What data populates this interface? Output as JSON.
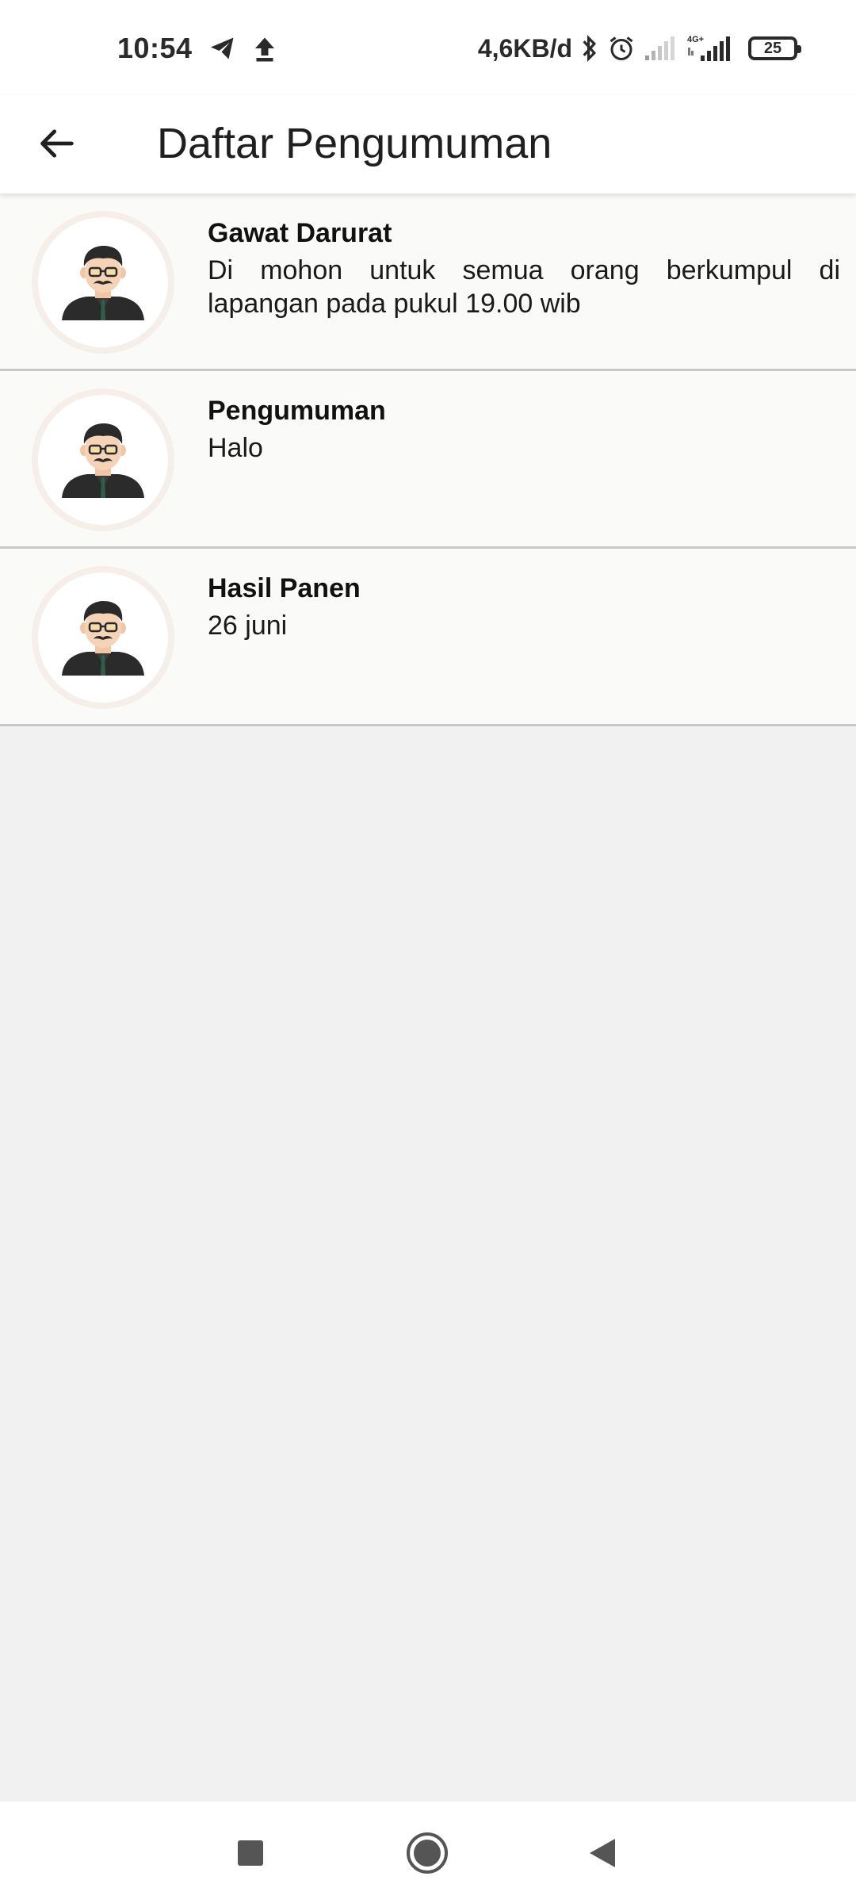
{
  "status_bar": {
    "time": "10:54",
    "net_speed": "4,6KB/d",
    "network_type": "4G+",
    "battery_level": "25",
    "icons": [
      "telegram-icon",
      "upload-icon",
      "bluetooth-icon",
      "alarm-icon",
      "signal-icon",
      "signal-4g-icon",
      "battery-icon"
    ]
  },
  "app_bar": {
    "title": "Daftar Pengumuman",
    "back_icon": "arrow-left-icon"
  },
  "announcements": [
    {
      "title": "Gawat Darurat",
      "body": "Di mohon untuk semua orang berkumpul di lapangan pada pukul 19.00 wib",
      "avatar_icon": "man-avatar-icon"
    },
    {
      "title": "Pengumuman",
      "body": "Halo",
      "avatar_icon": "man-avatar-icon"
    },
    {
      "title": "Hasil Panen",
      "body": "26 juni",
      "avatar_icon": "man-avatar-icon"
    }
  ],
  "nav_bar": {
    "buttons": [
      "recents-square-icon",
      "home-circle-icon",
      "back-triangle-icon"
    ]
  },
  "colors": {
    "background": "#f1f1f1",
    "list_item_bg": "#fafaf9",
    "divider": "#c8c8c8",
    "avatar_ring": "#f6eee8"
  }
}
